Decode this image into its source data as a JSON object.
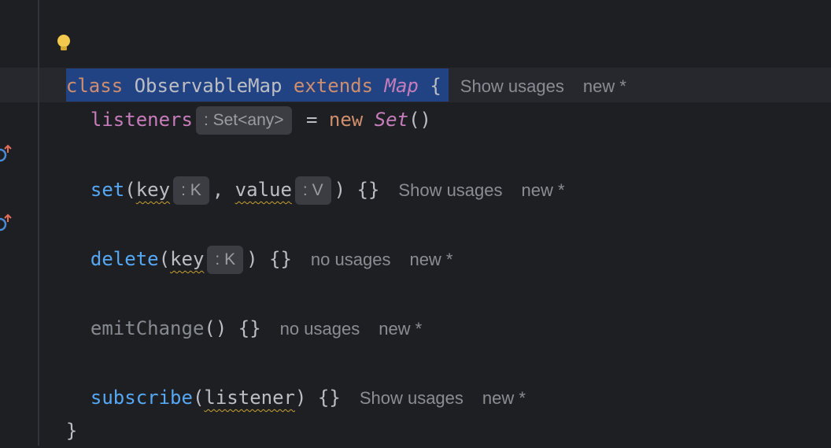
{
  "editor": {
    "line1": {
      "kw_class": "class",
      "class_name": "ObservableMap",
      "kw_extends": "extends",
      "base": "Map",
      "brace": "{",
      "usages": "Show usages",
      "author": "new *"
    },
    "line2": {
      "field": "listeners",
      "hint": ": Set<any>",
      "eq": "=",
      "kw_new": "new",
      "type": "Set",
      "call": "()"
    },
    "set_method": {
      "name": "set",
      "open": "(",
      "param1": "key",
      "hint1": ": K",
      "comma": ",",
      "param2": "value",
      "hint2": ": V",
      "close": ")",
      "body": "{}",
      "usages": "Show usages",
      "author": "new *"
    },
    "delete_method": {
      "name": "delete",
      "open": "(",
      "param1": "key",
      "hint1": ": K",
      "close": ")",
      "body": "{}",
      "usages": "no usages",
      "author": "new *"
    },
    "emit_method": {
      "name": "emitChange",
      "parens": "()",
      "body": "{}",
      "usages": "no usages",
      "author": "new *"
    },
    "subscribe_method": {
      "name": "subscribe",
      "open": "(",
      "param1": "listener",
      "close": ")",
      "body": "{}",
      "usages": "Show usages",
      "author": "new *"
    },
    "closing_brace": "}"
  },
  "icons": {
    "bulb": "lightbulb-icon",
    "override": "override-method-icon"
  },
  "colors": {
    "background": "#1e1f22",
    "selection": "#214283",
    "keyword": "#cf8e6d",
    "function": "#56a8f5",
    "field": "#c77dbb"
  }
}
